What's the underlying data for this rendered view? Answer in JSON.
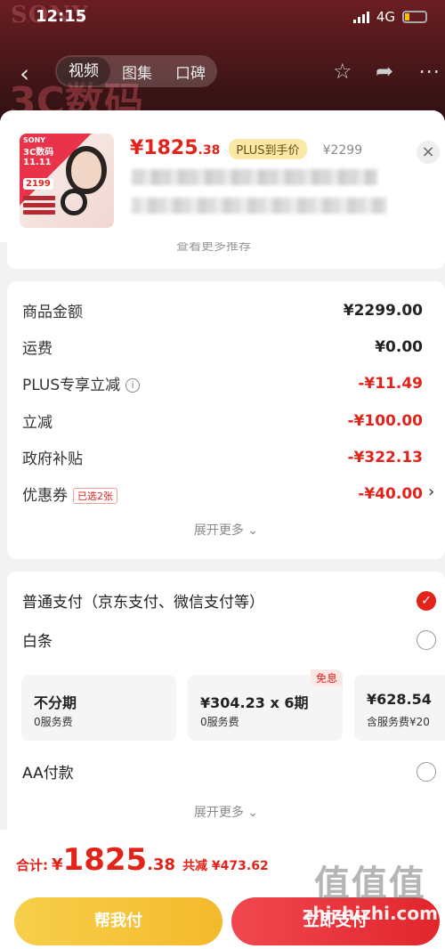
{
  "status_bar": {
    "time": "12:15",
    "network": "4G"
  },
  "background": {
    "brand": "SONY",
    "banner_text": "3C数码"
  },
  "nav": {
    "tabs": [
      "视频",
      "图集",
      "口碑"
    ],
    "active_tab": "视频"
  },
  "product": {
    "price_main": "¥1825",
    "price_decimal": ".38",
    "plus_tag": "PLUS到手价",
    "original_price": "¥2299",
    "thumb": {
      "brand": "SONY",
      "event": "3C数码\n11.11",
      "promo_price": "2199"
    }
  },
  "recommend": {
    "more_label": "查看更多推荐"
  },
  "breakdown": {
    "rows": [
      {
        "label": "商品金额",
        "value": "¥2299.00"
      },
      {
        "label": "运费",
        "value": "¥0.00"
      },
      {
        "label": "PLUS专享立减",
        "value": "-¥11.49"
      },
      {
        "label": "立减",
        "value": "-¥100.00"
      },
      {
        "label": "政府补贴",
        "value": "-¥322.13"
      },
      {
        "label": "优惠券",
        "value": "-¥40.00",
        "tag": "已选2张"
      }
    ],
    "expand_label": "展开更多"
  },
  "payment": {
    "methods": [
      {
        "label": "普通支付（京东支付、微信支付等）",
        "selected": true
      },
      {
        "label": "白条",
        "selected": false
      },
      {
        "label": "AA付款",
        "selected": false
      }
    ],
    "plans": [
      {
        "title": "不分期",
        "sub": "0服务费"
      },
      {
        "title": "¥304.23 x 6期",
        "sub": "0服务费",
        "tag": "免息"
      },
      {
        "title": "¥628.54",
        "sub": "含服务费¥20"
      }
    ],
    "expand_label": "展开更多"
  },
  "footer": {
    "total_label": "合计:",
    "currency": "¥",
    "total_int": "1825",
    "total_dec": ".38",
    "saved": "共减 ¥473.62",
    "help_pay_label": "帮我付",
    "pay_label": "立即支付"
  },
  "watermark": {
    "glyphs": "值值值",
    "text": "zhizhizhi.com"
  },
  "colors": {
    "accent": "#e2231a",
    "plus_bg": "#fbe8a6",
    "help_btn": "#f4b92c"
  }
}
